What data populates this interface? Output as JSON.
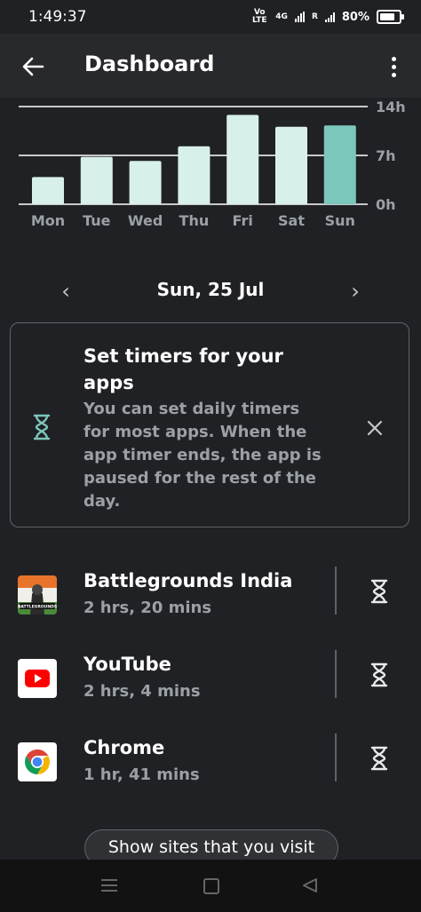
{
  "status": {
    "time": "1:49:37",
    "net_label": "Vo LTE",
    "net_gen": "4G",
    "sim_label": "R",
    "battery_pct": "80%",
    "battery_level": 0.8
  },
  "app_bar": {
    "title": "Dashboard",
    "back_icon": "arrow-left-icon",
    "menu_icon": "more-vert-icon"
  },
  "chart_data": {
    "type": "bar",
    "categories": [
      "Mon",
      "Tue",
      "Wed",
      "Thu",
      "Fri",
      "Sat",
      "Sun"
    ],
    "values": [
      3.9,
      6.8,
      6.2,
      8.3,
      12.8,
      11.1,
      11.3
    ],
    "selected_index": 6,
    "y_ticks": [
      "14h",
      "7h",
      "0h"
    ],
    "ylim": [
      0,
      14
    ],
    "grid": true,
    "colors": {
      "bar": "#d8f0ec",
      "selected": "#7cc7bc",
      "grid": "#ffffff"
    }
  },
  "date_nav": {
    "label": "Sun, 25 Jul",
    "prev": "‹",
    "next": "›"
  },
  "timer_card": {
    "title": "Set timers for your apps",
    "body": "You can set daily timers for most apps. When the app timer ends, the app is paused for the rest of the day.",
    "icon": "hourglass-icon",
    "accent": "#7cc7bc"
  },
  "apps": [
    {
      "name": "Battlegrounds India",
      "time": "2 hrs, 20 mins",
      "icon": "battlegrounds-icon"
    },
    {
      "name": "YouTube",
      "time": "2 hrs, 4 mins",
      "icon": "youtube-icon"
    },
    {
      "name": "Chrome",
      "time": "1 hr, 41 mins",
      "icon": "chrome-icon"
    }
  ],
  "bgmi_icon_text": "BATTLEGROUNDS",
  "sites_button": "Show sites that you visit"
}
